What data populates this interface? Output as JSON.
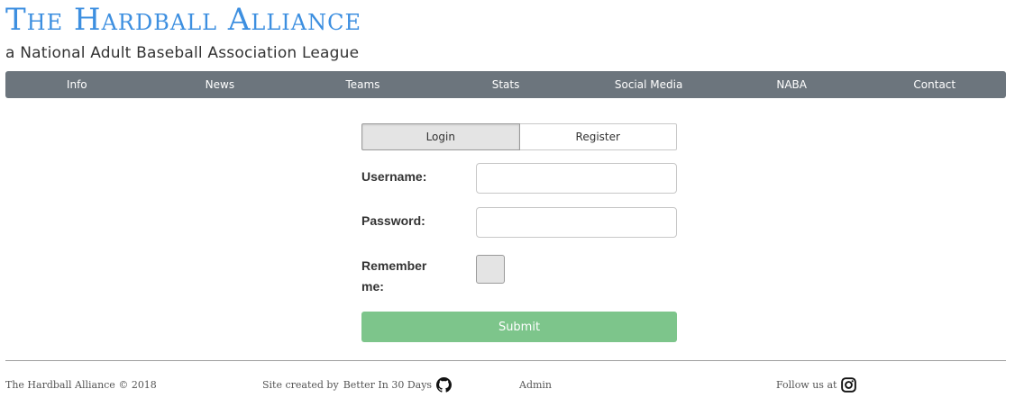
{
  "header": {
    "title": "The Hardball Alliance",
    "subtitle": "a National Adult Baseball Association League"
  },
  "nav": {
    "items": [
      {
        "label": "Info"
      },
      {
        "label": "News"
      },
      {
        "label": "Teams"
      },
      {
        "label": "Stats"
      },
      {
        "label": "Social Media"
      },
      {
        "label": "NABA"
      },
      {
        "label": "Contact"
      }
    ]
  },
  "form": {
    "tabs": [
      {
        "label": "Login",
        "active": true
      },
      {
        "label": "Register",
        "active": false
      }
    ],
    "username_label": "Username:",
    "username_value": "",
    "password_label": "Password:",
    "password_value": "",
    "remember_label": "Remember me:",
    "remember_checked": false,
    "submit_label": "Submit"
  },
  "footer": {
    "copyright": "The Hardball Alliance © 2018",
    "credit_prefix": "Site created by",
    "credit_name": "Better In 30 Days",
    "admin_link": "Admin",
    "follow_label": "Follow us at"
  },
  "colors": {
    "title": "#3d8fe0",
    "navbar": "#6c757d",
    "submit": "#7dc58b"
  },
  "icons": {
    "github": "github-icon",
    "instagram": "instagram-icon"
  }
}
